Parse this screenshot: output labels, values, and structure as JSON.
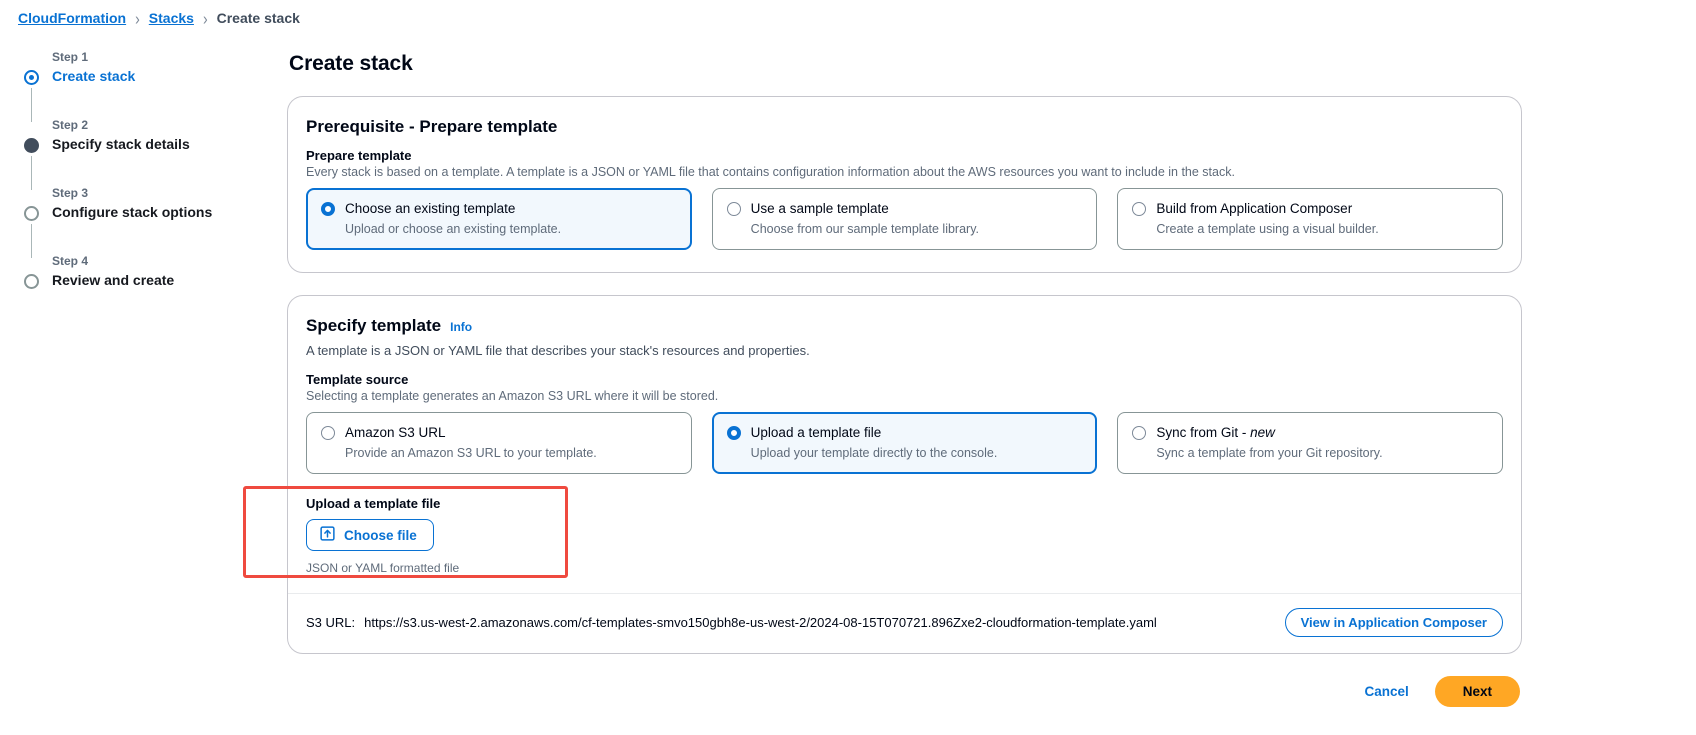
{
  "breadcrumb": {
    "items": [
      {
        "label": "CloudFormation",
        "link": true
      },
      {
        "label": "Stacks",
        "link": true
      },
      {
        "label": "Create stack",
        "link": false
      }
    ],
    "separator": "›"
  },
  "wizard": {
    "steps": [
      {
        "number": "Step 1",
        "label": "Create stack",
        "state": "active"
      },
      {
        "number": "Step 2",
        "label": "Specify stack details",
        "state": "done"
      },
      {
        "number": "Step 3",
        "label": "Configure stack options",
        "state": "todo"
      },
      {
        "number": "Step 4",
        "label": "Review and create",
        "state": "todo"
      }
    ]
  },
  "page": {
    "title": "Create stack"
  },
  "prerequisite": {
    "title": "Prerequisite - Prepare template",
    "field_label": "Prepare template",
    "field_hint": "Every stack is based on a template. A template is a JSON or YAML file that contains configuration information about the AWS resources you want to include in the stack.",
    "options": [
      {
        "label": "Choose an existing template",
        "desc": "Upload or choose an existing template.",
        "selected": true
      },
      {
        "label": "Use a sample template",
        "desc": "Choose from our sample template library.",
        "selected": false
      },
      {
        "label": "Build from Application Composer",
        "desc": "Create a template using a visual builder.",
        "selected": false
      }
    ]
  },
  "specify_template": {
    "title": "Specify template",
    "info_label": "Info",
    "description": "A template is a JSON or YAML file that describes your stack's resources and properties.",
    "field_label": "Template source",
    "field_hint": "Selecting a template generates an Amazon S3 URL where it will be stored.",
    "options": [
      {
        "label": "Amazon S3 URL",
        "label_em": "",
        "desc": "Provide an Amazon S3 URL to your template.",
        "selected": false
      },
      {
        "label": "Upload a template file",
        "label_em": "",
        "desc": "Upload your template directly to the console.",
        "selected": true
      },
      {
        "label": "Sync from Git - ",
        "label_em": "new",
        "desc": "Sync a template from your Git repository.",
        "selected": false
      }
    ],
    "upload": {
      "label": "Upload a template file",
      "button_label": "Choose file",
      "button_icon": "upload-icon",
      "hint": "JSON or YAML formatted file",
      "highlight_color": "#ef4a3f"
    },
    "s3": {
      "label": "S3 URL:",
      "url": "https://s3.us-west-2.amazonaws.com/cf-templates-smvo150gbh8e-us-west-2/2024-08-15T070721.896Zxe2-cloudformation-template.yaml",
      "composer_button": "View in Application Composer"
    }
  },
  "footer": {
    "cancel_label": "Cancel",
    "next_label": "Next",
    "next_color": "#ffa724"
  }
}
